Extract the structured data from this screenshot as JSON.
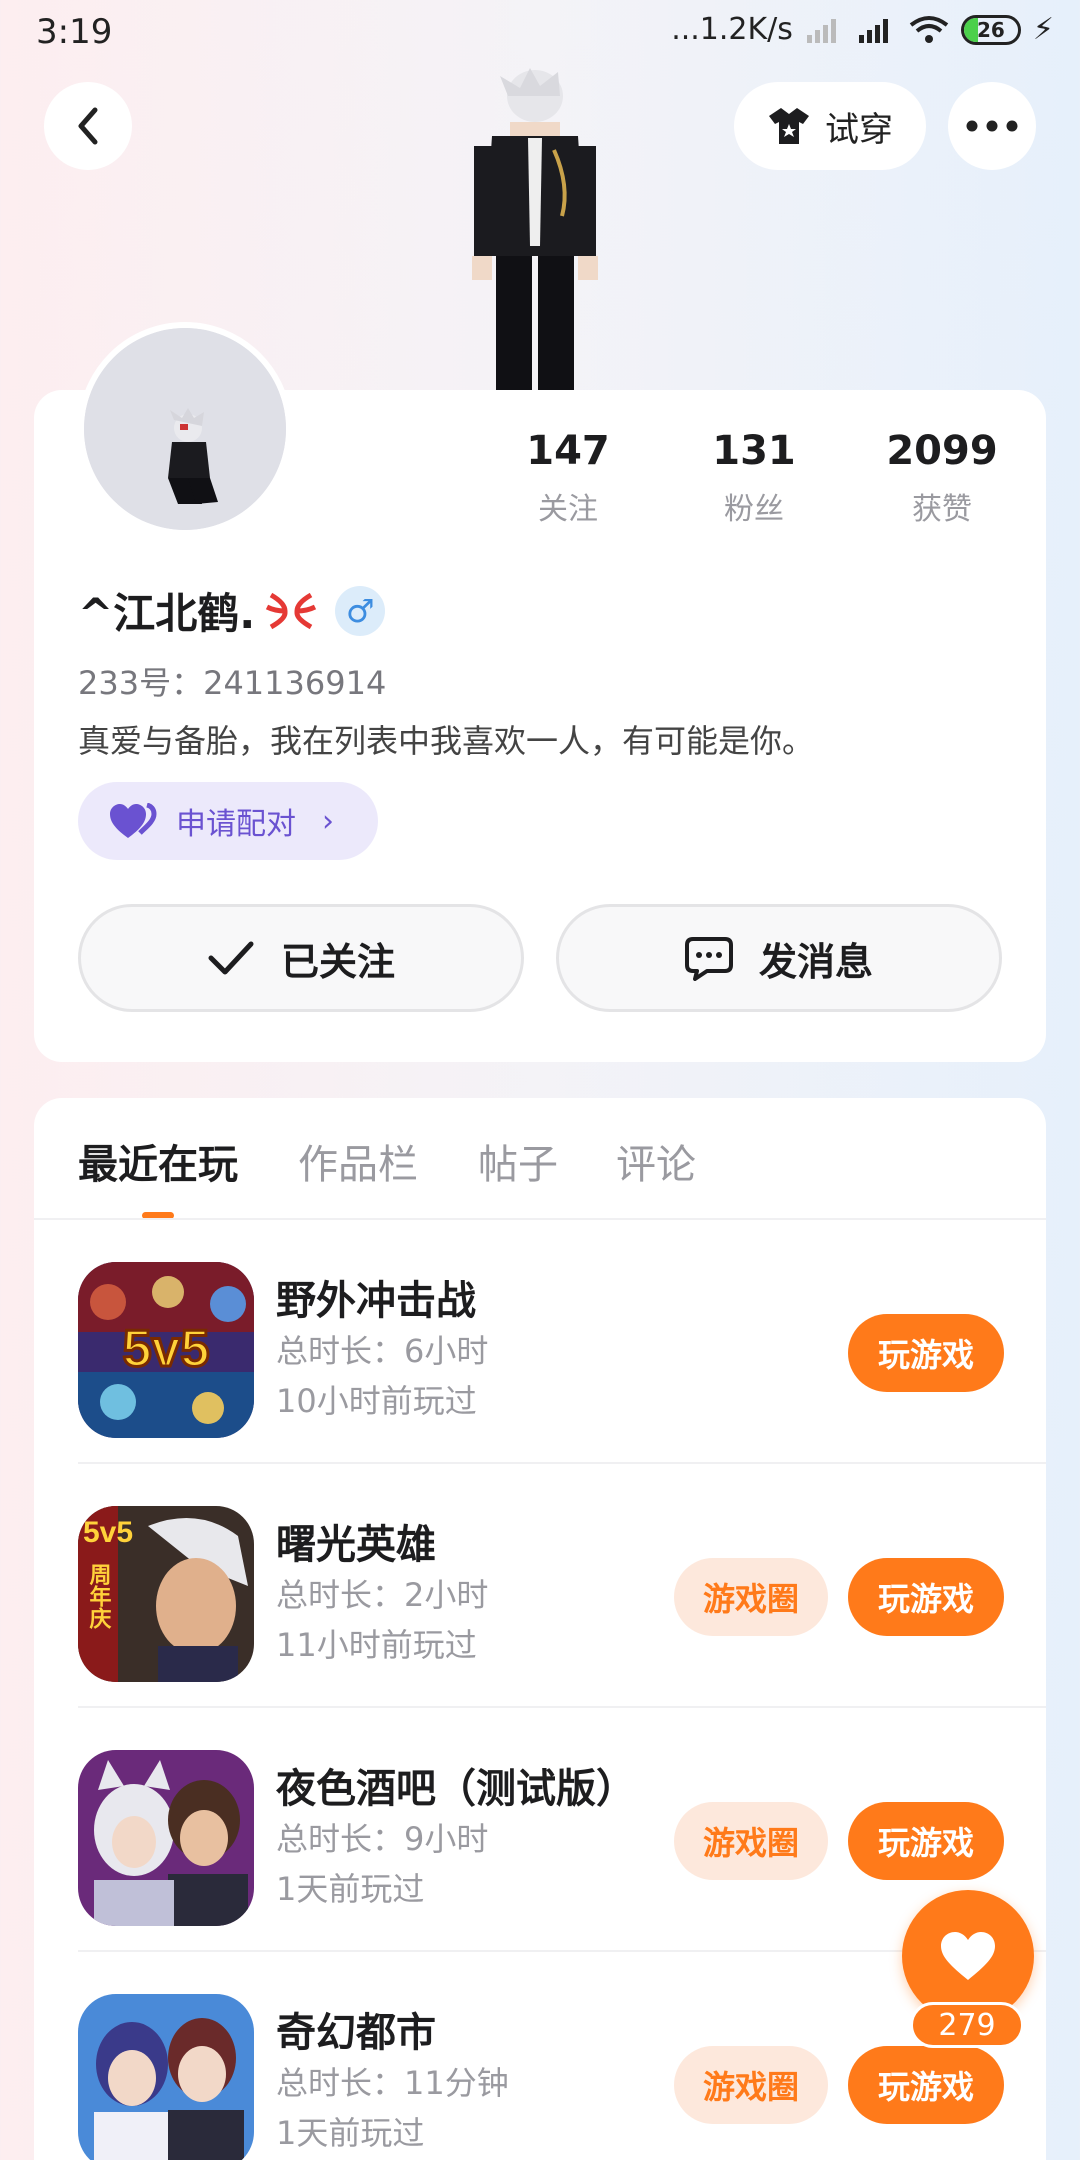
{
  "status_bar": {
    "time": "3:19",
    "network_speed": "...1.2K/s",
    "battery": "26",
    "battery_level": 0.26
  },
  "header": {
    "tryon_label": "试穿"
  },
  "profile": {
    "stats": [
      {
        "value": "147",
        "label": "关注"
      },
      {
        "value": "131",
        "label": "粉丝"
      },
      {
        "value": "2099",
        "label": "获赞"
      }
    ],
    "name": "^江北鹤.",
    "gender_symbol": "♂",
    "id_label": "233号：241136914",
    "bio": "真爱与备胎，我在列表中我喜欢一人，有可能是你。",
    "pair_label": "申请配对"
  },
  "actions": {
    "follow_label": "已关注",
    "message_label": "发消息"
  },
  "tabs": [
    {
      "label": "最近在玩"
    },
    {
      "label": "作品栏"
    },
    {
      "label": "帖子"
    },
    {
      "label": "评论"
    }
  ],
  "games": [
    {
      "title": "野外冲击战",
      "duration": "总时长：6小时",
      "last_played": "10小时前玩过",
      "icon_text": "5v5",
      "play_label": "玩游戏"
    },
    {
      "title": "曙光英雄",
      "duration": "总时长：2小时",
      "last_played": "11小时前玩过",
      "icon_text": "5v5",
      "icon_subtext": "周年庆",
      "circle_label": "游戏圈",
      "play_label": "玩游戏"
    },
    {
      "title": "夜色酒吧（测试版）",
      "duration": "总时长：9小时",
      "last_played": "1天前玩过",
      "circle_label": "游戏圈",
      "play_label": "玩游戏"
    },
    {
      "title": "奇幻都市",
      "duration": "总时长：11分钟",
      "last_played": "1天前玩过",
      "circle_label": "游戏圈",
      "play_label": "玩游戏"
    }
  ],
  "floating": {
    "like_count": "279"
  },
  "colors": {
    "accent": "#ff7a1a",
    "pair": "#6a52d1"
  }
}
